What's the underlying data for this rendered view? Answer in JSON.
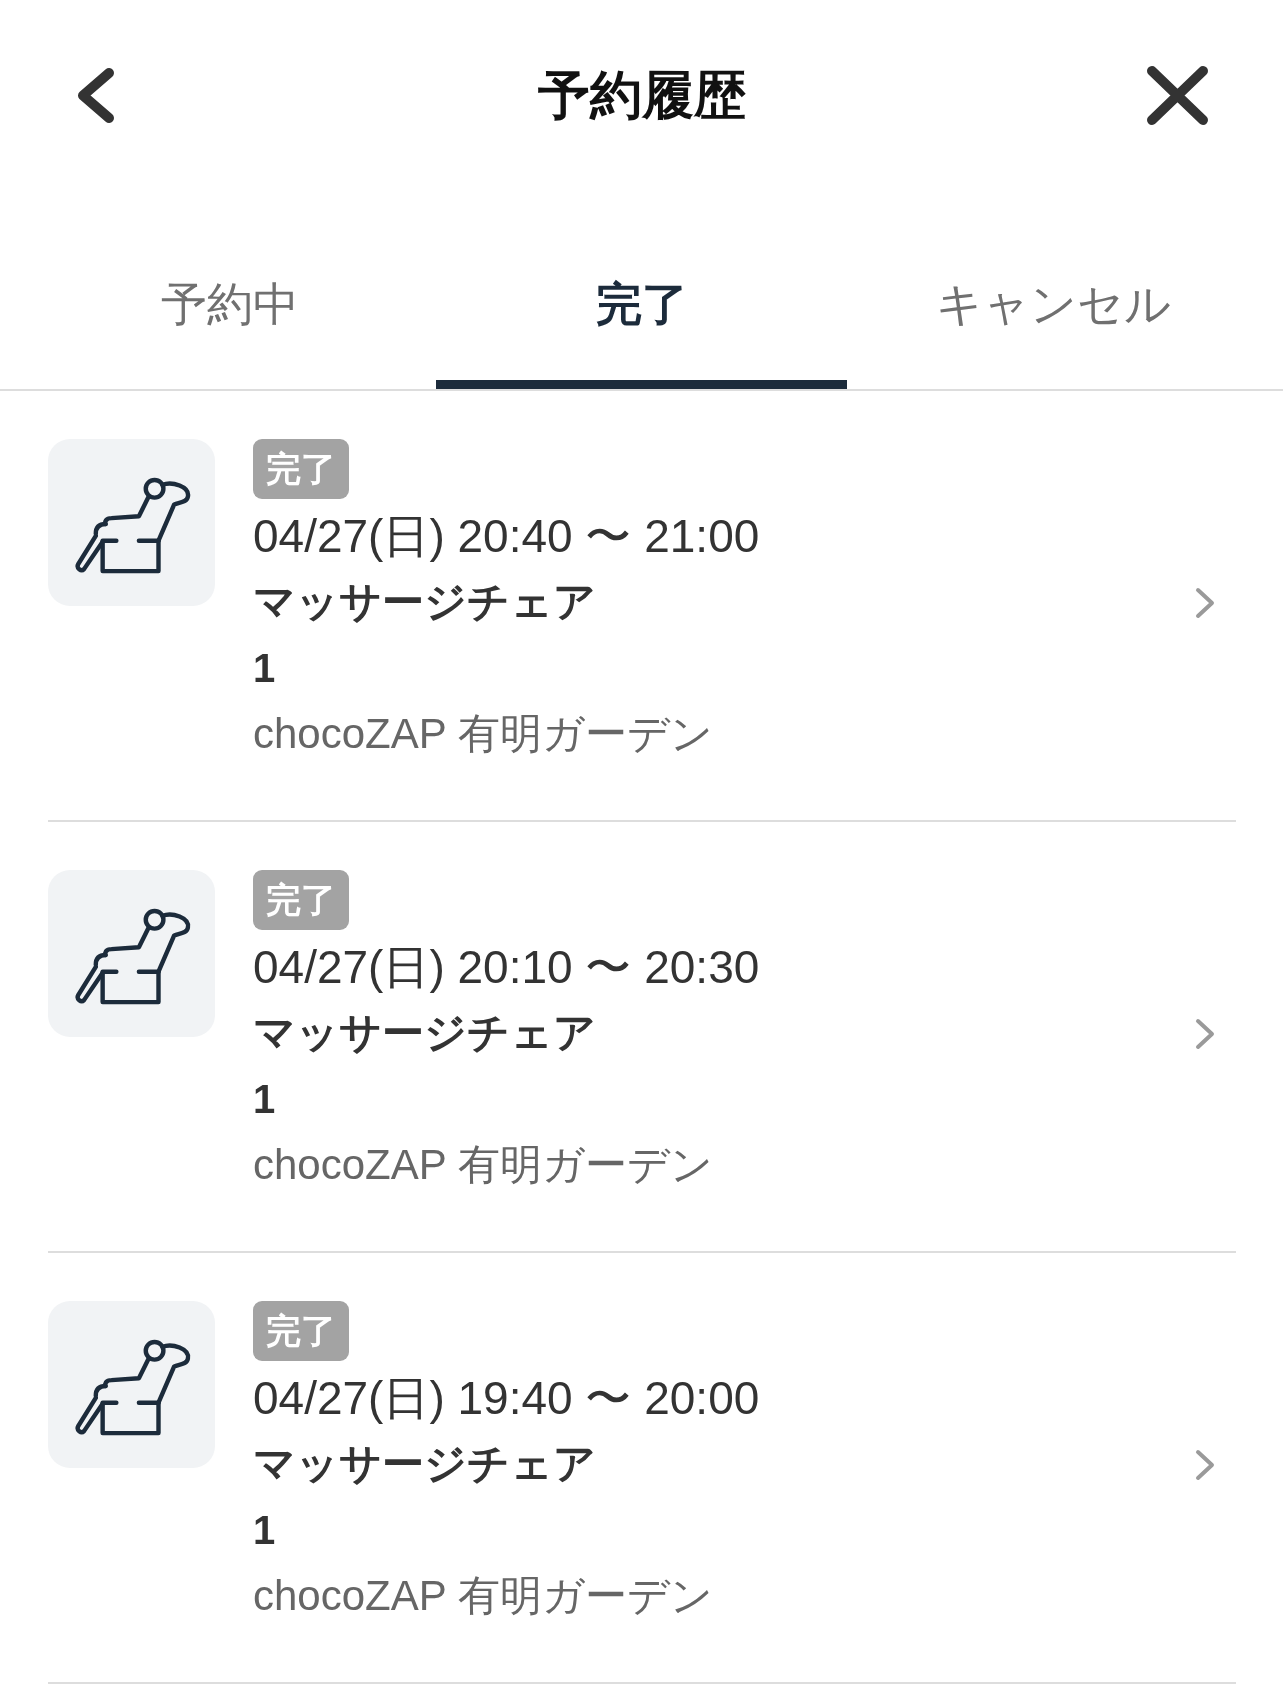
{
  "header": {
    "title": "予約履歴"
  },
  "tabs": [
    {
      "label": "予約中",
      "selected": false
    },
    {
      "label": "完了",
      "selected": true
    },
    {
      "label": "キャンセル",
      "selected": false
    }
  ],
  "reservations": [
    {
      "status": "完了",
      "time": "04/27(日) 20:40 〜 21:00",
      "equipment": "マッサージチェア",
      "quantity": "1",
      "store": "chocoZAP 有明ガーデン"
    },
    {
      "status": "完了",
      "time": "04/27(日) 20:10 〜 20:30",
      "equipment": "マッサージチェア",
      "quantity": "1",
      "store": "chocoZAP 有明ガーデン"
    },
    {
      "status": "完了",
      "time": "04/27(日) 19:40 〜 20:00",
      "equipment": "マッサージチェア",
      "quantity": "1",
      "store": "chocoZAP 有明ガーデン"
    }
  ]
}
